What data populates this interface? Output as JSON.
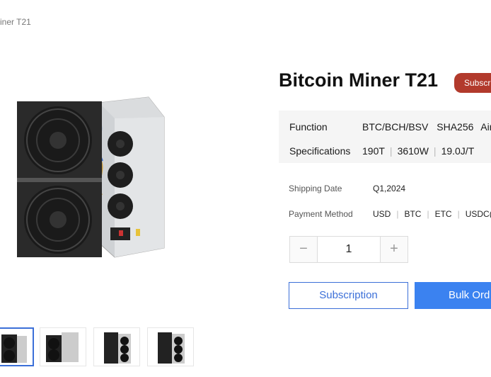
{
  "breadcrumb": {
    "current": "iner T21"
  },
  "product": {
    "title": "Bitcoin Miner T21",
    "badge": "Subscr"
  },
  "specs": {
    "function_label": "Function",
    "function_values": [
      "BTC/BCH/BSV",
      "SHA256",
      "Air-c"
    ],
    "spec_label": "Specifications",
    "spec_values": [
      "190T",
      "3610W",
      "19.0J/T"
    ]
  },
  "shipping": {
    "label": "Shipping Date",
    "value": "Q1,2024"
  },
  "payment": {
    "label": "Payment Method",
    "values": [
      "USD",
      "BTC",
      "ETC",
      "USDC(E"
    ]
  },
  "quantity": {
    "minus": "−",
    "value": "1",
    "plus": "+"
  },
  "actions": {
    "subscription": "Subscription",
    "bulk": "Bulk Ord"
  },
  "colors": {
    "accent": "#3b82f0",
    "badge": "#b23a2c"
  },
  "thumbnails": 4
}
